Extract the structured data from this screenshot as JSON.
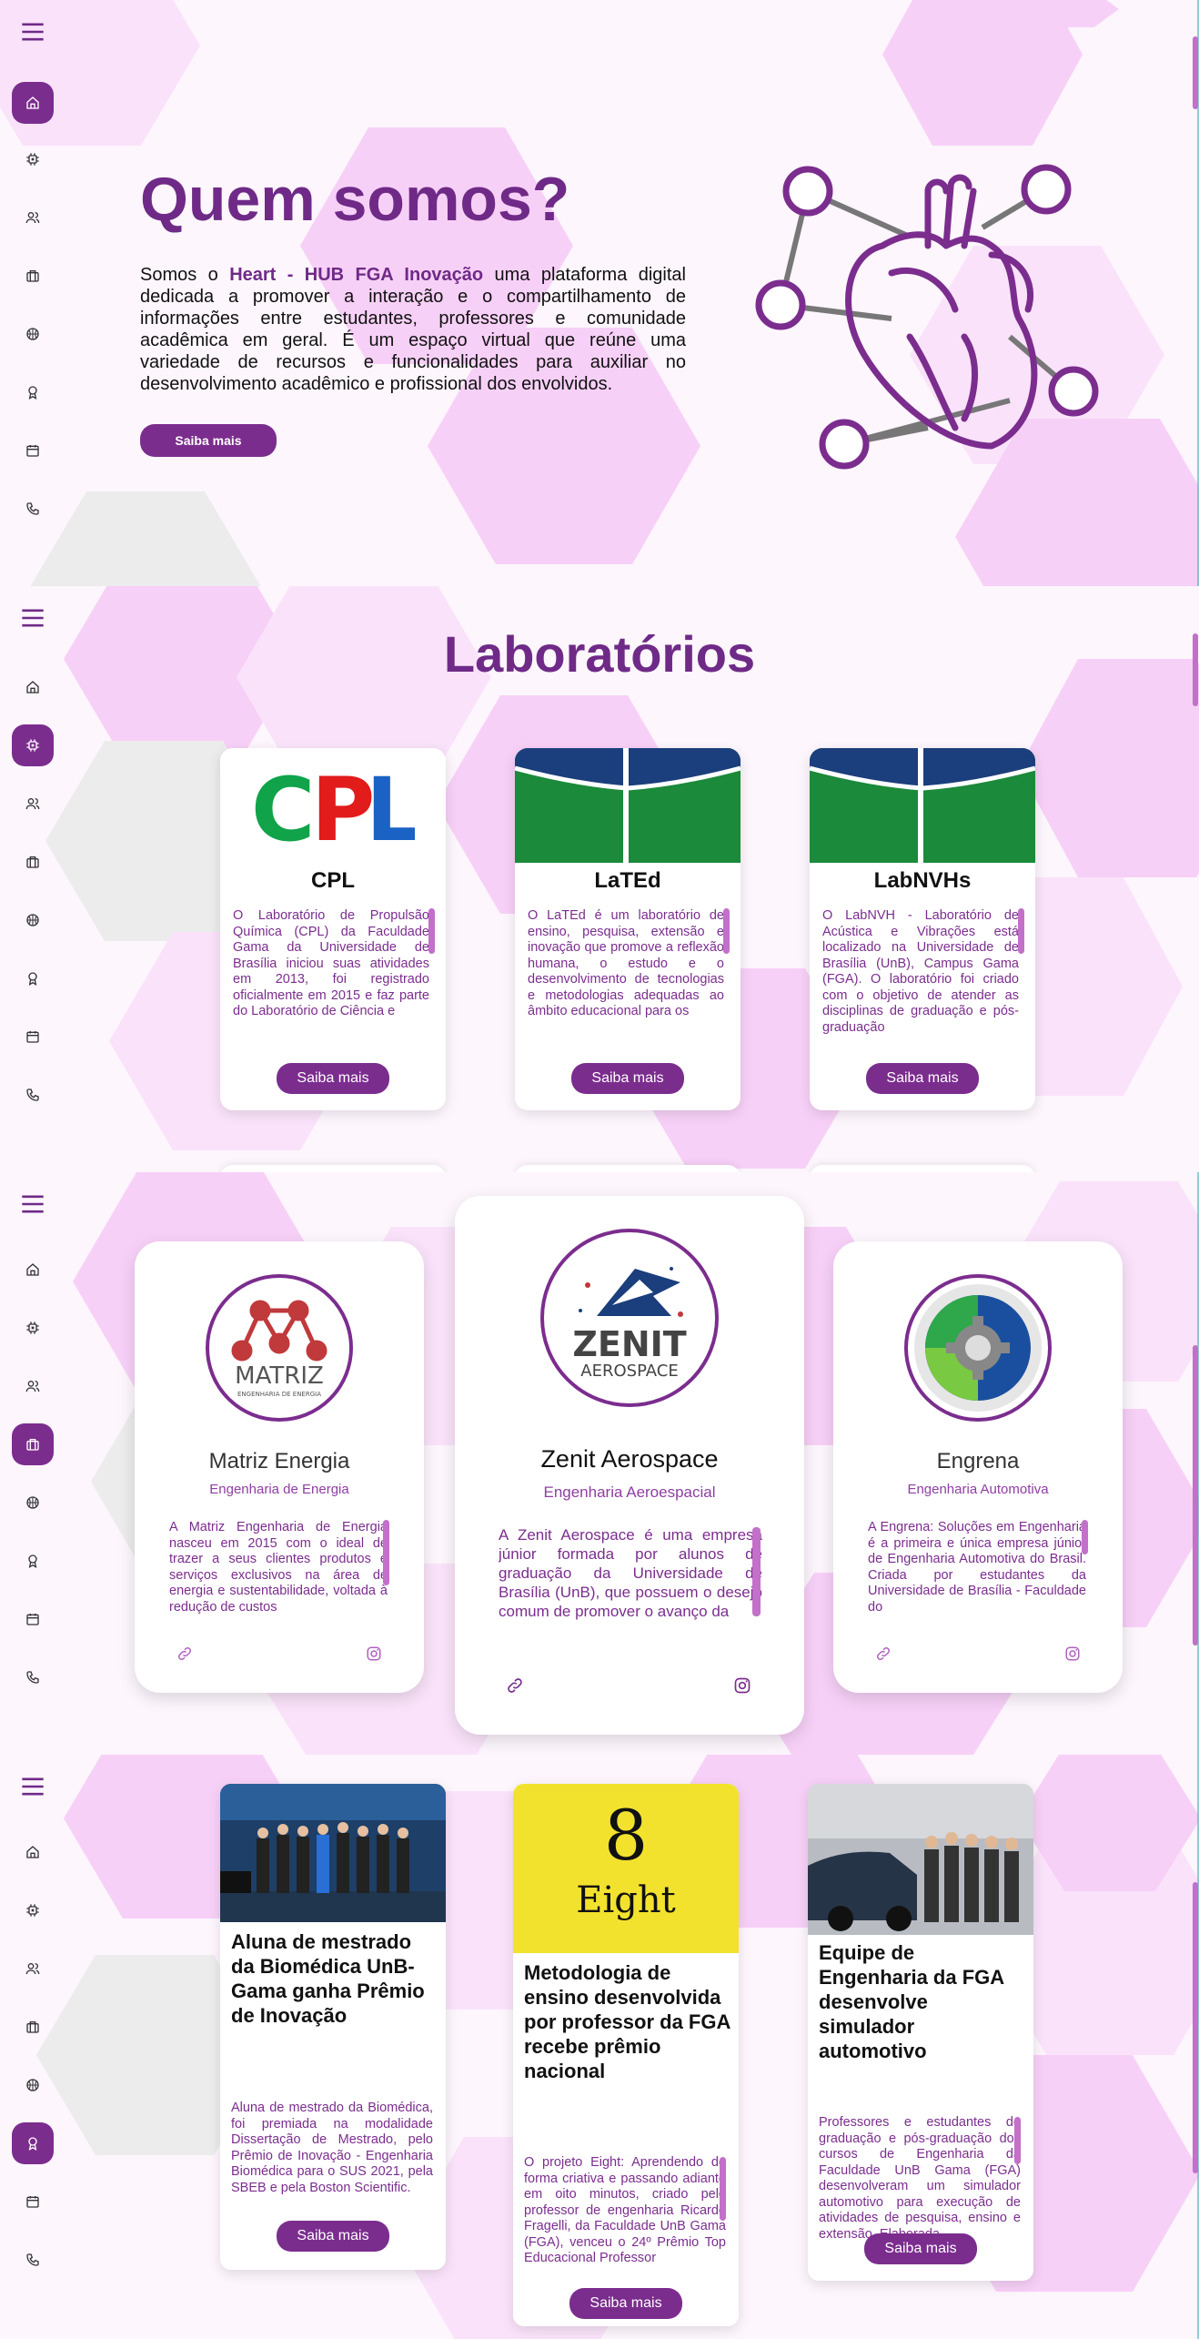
{
  "sidebar": {
    "menu_icon": "hamburger-icon",
    "items": [
      {
        "icon": "home-icon"
      },
      {
        "icon": "chip-icon"
      },
      {
        "icon": "users-icon"
      },
      {
        "icon": "briefcase-icon"
      },
      {
        "icon": "basketball-icon"
      },
      {
        "icon": "award-icon"
      },
      {
        "icon": "calendar-icon"
      },
      {
        "icon": "phone-icon"
      }
    ]
  },
  "hero": {
    "title": "Quem somos?",
    "text_prefix": "Somos o ",
    "brand": "Heart - HUB FGA Inovação",
    "text_suffix": " uma plataforma digital dedicada a promover a interação e o compartilhamento de informações entre estudantes, professores e comunidade acadêmica em geral. É um espaço virtual que reúne uma variedade de recursos e funcionalidades para auxiliar no desenvolvimento acadêmico e profissional dos envolvidos.",
    "button": "Saiba mais"
  },
  "labs": {
    "title": "Laboratórios",
    "cards": [
      {
        "name": "CPL",
        "logo_text": "CPL",
        "description": "O Laboratório de Propulsão Química (CPL) da Faculdade Gama da Universidade de Brasília iniciou suas atividades em 2013, foi registrado oficialmente em 2015 e faz parte do Laboratório de Ciência e",
        "button": "Saiba mais"
      },
      {
        "name": "LaTEd",
        "description": "O LaTEd é um laboratório de ensino, pesquisa, extensão e inovação que promove a reflexão humana, o estudo e o desenvolvimento de tecnologias e metodologias adequadas ao âmbito educacional para os",
        "button": "Saiba mais"
      },
      {
        "name": "LabNVHs",
        "description": "O LabNVH - Laboratório de Acústica e Vibrações está localizado na Universidade de Brasília (UnB), Campus Gama (FGA). O laboratório foi criado com o objetivo de atender as disciplinas de graduação e pós-graduação",
        "button": "Saiba mais"
      }
    ]
  },
  "empresas": {
    "cards": [
      {
        "name": "Matriz Energia",
        "subtitle": "Engenharia de Energia",
        "logo_text": "MATRIZ",
        "logo_subtext": "ENGENHARIA DE ENERGIA",
        "description": "A Matriz Engenharia de Energia nasceu em 2015 com o ideal de trazer a seus clientes produtos e serviços exclusivos na área de energia e sustentabilidade, voltada à redução de custos"
      },
      {
        "name": "Zenit Aerospace",
        "subtitle": "Engenharia Aeroespacial",
        "logo_text": "ZENIT",
        "logo_subtext": "AEROSPACE",
        "description": "A Zenit Aerospace é uma empresa júnior formada por alunos de graduação da Universidade de Brasília (UnB), que possuem o desejo comum de promover o avanço da"
      },
      {
        "name": "Engrena",
        "subtitle": "Engenharia Automotiva",
        "description": "A Engrena: Soluções em Engenharia é a primeira e única empresa júnior de Engenharia Automotiva do Brasil. Criada por estudantes da Universidade de Brasília - Faculdade do"
      }
    ]
  },
  "news": {
    "cards": [
      {
        "title": "Aluna de mestrado da Biomédica UnB-Gama ganha Prêmio de Inovação",
        "description": "Aluna de mestrado da Biomédica, foi premiada na modalidade Dissertação de Mestrado, pelo Prêmio de Inovação - Engenharia Biomédica para o SUS 2021, pela SBEB e pela Boston Scientific.",
        "button": "Saiba mais"
      },
      {
        "title": "Metodologia de ensino desenvolvida por professor da FGA recebe prêmio nacional",
        "logo_number": "8",
        "logo_word": "Eight",
        "description": "O projeto Eight: Aprendendo de forma criativa e passando adiante em oito minutos, criado pelo professor de engenharia Ricardo Fragelli, da Faculdade UnB Gama (FGA), venceu o 24º Prêmio Top Educacional Professor",
        "button": "Saiba mais"
      },
      {
        "title": "Equipe de Engenharia da FGA desenvolve simulador automotivo",
        "description": "Professores e estudantes de graduação e pós-graduação dos cursos de Engenharia da Faculdade UnB Gama (FGA) desenvolveram um simulador automotivo para execução de atividades de pesquisa, ensino e extensão. Elaborada",
        "button": "Saiba mais"
      }
    ]
  },
  "colors": {
    "accent": "#7b2d8e",
    "hex_pink": "#f7d0f7",
    "hex_gray": "#ececec"
  }
}
